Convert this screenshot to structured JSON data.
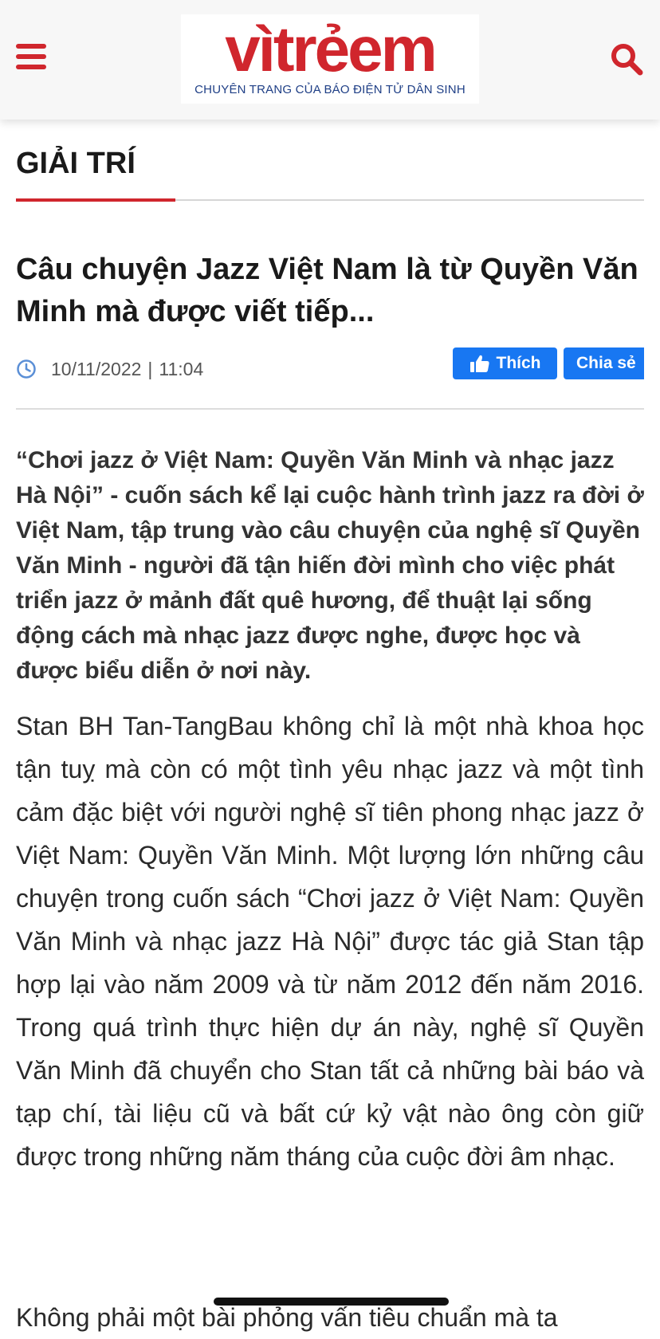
{
  "header": {
    "logo_text": "vìtrẻem",
    "logo_tagline": "CHUYÊN TRANG CỦA BÁO ĐIỆN TỬ DÂN SINH",
    "brand_color": "#d0262d",
    "menu_icon": "hamburger-menu-icon",
    "search_icon": "search-icon"
  },
  "section": {
    "title": "GIẢI TRÍ"
  },
  "article": {
    "title": "Câu chuyện Jazz Việt Nam là từ Quyền Văn Minh mà được viết tiếp...",
    "date": "10/11/2022",
    "separator": "|",
    "time": "11:04",
    "lead": "“Chơi jazz ở Việt Nam: Quyền Văn Minh và nhạc jazz Hà Nội” - cuốn sách kể lại cuộc hành trình jazz ra đời ở Việt Nam, tập trung vào câu chuyện của nghệ sĩ Quyền Văn Minh - người đã tận hiến đời mình cho việc phát triển jazz ở mảnh đất quê hương, để thuật lại sống động cách mà nhạc jazz được nghe, được học và được biểu diễn ở nơi này.",
    "paragraph_1": "Stan BH Tan-TangBau không chỉ là một nhà khoa học tận tuỵ mà còn có một tình yêu nhạc jazz và một tình cảm đặc biệt với người nghệ sĩ tiên phong nhạc jazz ở Việt Nam: Quyền Văn Minh. Một lượng lớn những câu chuyện trong cuốn sách “Chơi jazz ở Việt Nam: Quyền Văn Minh và nhạc jazz Hà Nội” được tác giả Stan tập hợp lại vào năm 2009 và từ năm 2012 đến năm 2016. Trong quá trình thực hiện dự án này, nghệ sĩ Quyền Văn Minh đã chuyển cho Stan tất cả những bài báo và tạp chí, tài liệu cũ và bất cứ kỷ vật nào ông còn giữ được trong những năm tháng của cuộc đời âm nhạc.",
    "paragraph_2_partial": "Không phải một bài phỏng vấn tiêu chuẩn mà ta"
  },
  "social": {
    "like_label": "Thích",
    "share_label": "Chia sẻ",
    "button_color": "#1877f2"
  }
}
